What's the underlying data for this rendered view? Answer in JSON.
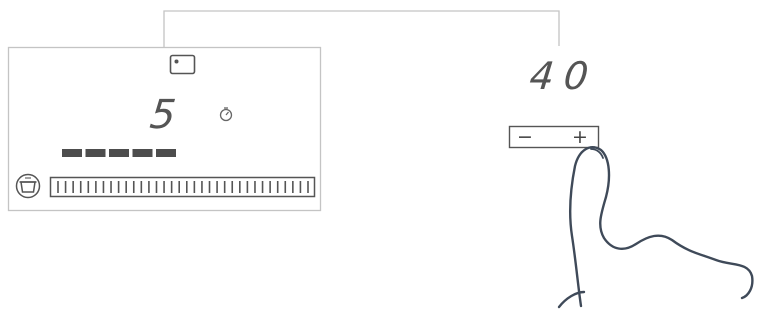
{
  "diagram": {
    "power_level_display": "5",
    "timer_display": "40",
    "minus_symbol": "−",
    "plus_symbol": "+",
    "power_bars_lit": 5,
    "slider_ticks": 34,
    "icons": {
      "zone_indicator": "rectangle-zone-icon",
      "timer": "stopwatch-icon",
      "pot": "pot-icon",
      "hand": "pointing-hand-icon"
    },
    "colors": {
      "line": "#b9b9b9",
      "digit": "#555555",
      "bar": "#4d4d4d",
      "hand": "#3f4a59",
      "hand_fill": "#ffffff"
    }
  }
}
